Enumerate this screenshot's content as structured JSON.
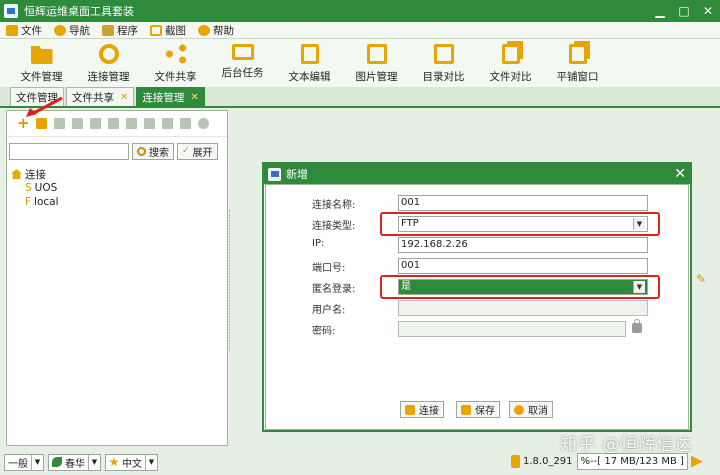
{
  "window": {
    "title": "恒辉运维桌面工具套装",
    "ctrl_min": "▁",
    "ctrl_max": "□",
    "ctrl_close": "✕"
  },
  "menu": [
    {
      "label": "文件",
      "icon": "folder-icon",
      "color": "#e8a400"
    },
    {
      "label": "导航",
      "icon": "compass-icon",
      "color": "#e8a400"
    },
    {
      "label": "程序",
      "icon": "app-icon",
      "color": "#c9a23a"
    },
    {
      "label": "截图",
      "icon": "screenshot-icon",
      "color": "#e8a400"
    },
    {
      "label": "帮助",
      "icon": "help-icon",
      "color": "#e8a400"
    }
  ],
  "toolbar": [
    {
      "label": "文件管理",
      "icon": "folder-open-icon"
    },
    {
      "label": "连接管理",
      "icon": "link-icon"
    },
    {
      "label": "文件共享",
      "icon": "share-icon"
    },
    {
      "label": "后台任务",
      "icon": "monitor-icon"
    },
    {
      "label": "文本编辑",
      "icon": "edit-icon"
    },
    {
      "label": "图片管理",
      "icon": "image-icon"
    },
    {
      "label": "目录对比",
      "icon": "folder-compare-icon"
    },
    {
      "label": "文件对比",
      "icon": "file-compare-icon"
    },
    {
      "label": "平铺窗口",
      "icon": "tile-windows-icon"
    }
  ],
  "tabs": [
    {
      "label": "文件管理",
      "closable": false,
      "active": false
    },
    {
      "label": "文件共享",
      "closable": true,
      "active": false
    },
    {
      "label": "连接管理",
      "closable": true,
      "active": true
    }
  ],
  "tab_close": "✕",
  "left": {
    "search_button": "搜索",
    "expand_button": "展开",
    "tree_root": "连接",
    "tree_items": [
      {
        "prefix": "S",
        "label": "UOS"
      },
      {
        "prefix": "F",
        "label": "local"
      }
    ],
    "add_glyph": "+"
  },
  "dialog": {
    "title": "新增",
    "close": "✕",
    "fields": [
      {
        "label": "连接名称:",
        "value": "001",
        "type": "text"
      },
      {
        "label": "连接类型:",
        "value": "FTP",
        "type": "select"
      },
      {
        "label": "IP:",
        "value": "192.168.2.26",
        "type": "text"
      },
      {
        "label": "端口号:",
        "value": "001",
        "type": "text"
      },
      {
        "label": "匿名登录:",
        "value": "是",
        "type": "select-green"
      },
      {
        "label": "用户名:",
        "value": "",
        "type": "disabled"
      },
      {
        "label": "密码:",
        "value": "",
        "type": "disabled-lock"
      }
    ],
    "dropdown_glyph": "▼",
    "buttons": [
      {
        "label": "连接",
        "icon": "connect-icon"
      },
      {
        "label": "保存",
        "icon": "save-icon"
      },
      {
        "label": "取消",
        "icon": "cancel-icon"
      }
    ]
  },
  "status": {
    "combo1": "一般",
    "combo2": "春华",
    "combo3": "中文",
    "version": "1.8.0_291",
    "mem": "%--[ 17 MB/123 MB ]"
  },
  "watermark": "知乎 @恒辉信达",
  "colors": {
    "accent": "#2f8a3c",
    "highlight": "#e32020",
    "icon_gold": "#e8a400"
  }
}
